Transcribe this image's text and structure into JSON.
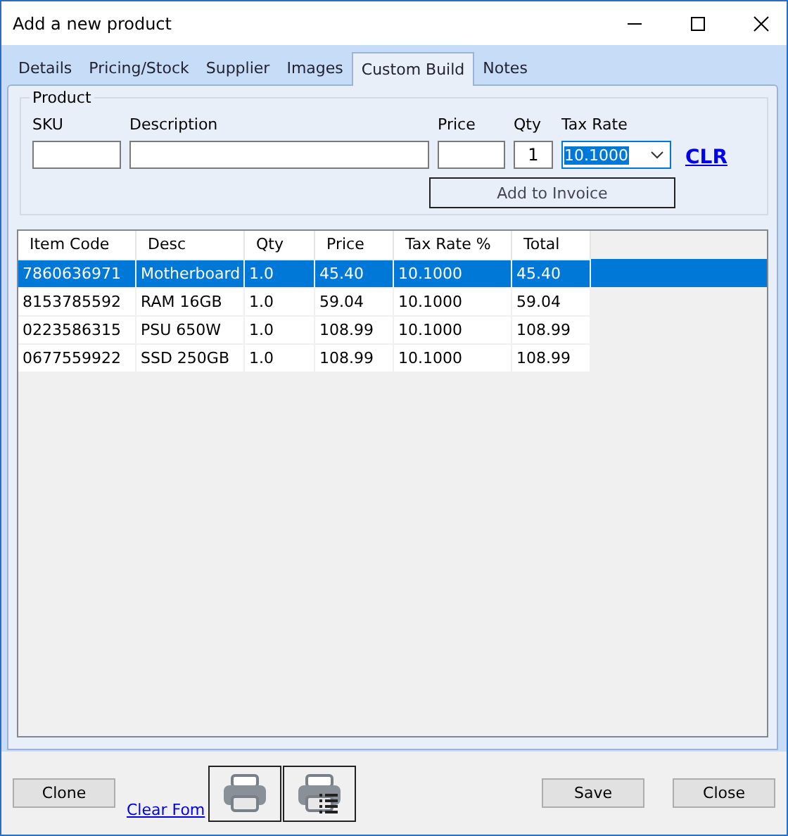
{
  "window": {
    "title": "Add a new product"
  },
  "tabs": [
    {
      "label": "Details",
      "selected": false
    },
    {
      "label": "Pricing/Stock",
      "selected": false
    },
    {
      "label": "Supplier",
      "selected": false
    },
    {
      "label": "Images",
      "selected": false
    },
    {
      "label": "Custom Build",
      "selected": true
    },
    {
      "label": "Notes",
      "selected": false
    }
  ],
  "product": {
    "title": "Product",
    "sku_label": "SKU",
    "description_label": "Description",
    "price_label": "Price",
    "qty_label": "Qty",
    "qty_value": "1",
    "tax_rate_label": "Tax Rate",
    "tax_rate_value": "10.1000",
    "clear_link": "CLR",
    "add_button": "Add to Invoice"
  },
  "table": {
    "columns": [
      "Item Code",
      "Desc",
      "Qty",
      "Price",
      "Tax Rate %",
      "Total"
    ],
    "rows": [
      {
        "cells": [
          "7860636971",
          "Motherboard",
          "1.0",
          "45.40",
          "10.1000",
          "45.40"
        ],
        "selected": true
      },
      {
        "cells": [
          "8153785592",
          "RAM 16GB",
          "1.0",
          "59.04",
          "10.1000",
          "59.04"
        ],
        "selected": false
      },
      {
        "cells": [
          "0223586315",
          "PSU 650W",
          "1.0",
          "108.99",
          "10.1000",
          "108.99"
        ],
        "selected": false
      },
      {
        "cells": [
          "0677559922",
          "SSD 250GB",
          "1.0",
          "108.99",
          "10.1000",
          "108.99"
        ],
        "selected": false
      }
    ]
  },
  "footer": {
    "clone_button": "Clone",
    "clear_form_link": "Clear Fom",
    "save_button": "Save",
    "close_button": "Close"
  }
}
